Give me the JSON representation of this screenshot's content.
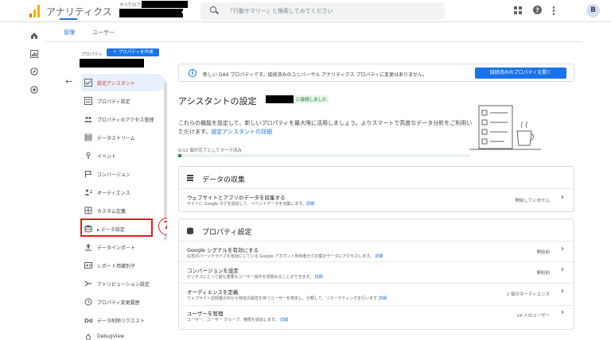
{
  "header": {
    "app_title": "アナリティクス",
    "account_label": "すべてのアカウント",
    "search_placeholder": "「行動サマリー」と検索してみてください",
    "avatar_letter": "B"
  },
  "tabs": [
    {
      "label": "管理"
    },
    {
      "label": "ユーザー"
    }
  ],
  "admin": {
    "property_label": "プロパティ",
    "create_property_button": "＋ プロパティを作成",
    "nav_items": [
      {
        "label": "設定アシスタント"
      },
      {
        "label": "プロパティ設定"
      },
      {
        "label": "プロパティのアクセス管理"
      },
      {
        "label": "データストリーム"
      },
      {
        "label": "イベント"
      },
      {
        "label": "コンバージョン"
      },
      {
        "label": "オーディエンス"
      },
      {
        "label": "カスタム定義"
      },
      {
        "label": "▸ データ設定"
      },
      {
        "label": "データインポート"
      },
      {
        "label": "レポート用識別子"
      },
      {
        "label": "アトリビューション設定"
      },
      {
        "label": "プロパティ変更履歴"
      },
      {
        "label": "データ削除リクエスト"
      },
      {
        "label": "DebugView"
      }
    ]
  },
  "annotation": {
    "step_number": "7",
    "highlight_color": "#e02020"
  },
  "main": {
    "banner_text": "新しい GA4 プロパティです。接続済みのユニバーサル アナリティクス プロパティに変更はありません。",
    "banner_button": "接続済みのプロパティを開く",
    "page_title": "アシスタントの設定",
    "title_badge": "に接続しました",
    "intro_text": "これらの機能を設定して、新しいプロパティを最大限に活用しましょう。よりスマートで高度なデータ分析をご利用いただけます。",
    "intro_link": "設定アシスタントの詳細",
    "progress_label": "0/12 個が完了としてマーク済み",
    "progress_fraction": 0.01,
    "collection_card": {
      "title": "データの収集",
      "rows": [
        {
          "title": "ウェブサイトとアプリのデータを収集する",
          "desc": "サイトに Google タグを追加して、イベントデータを収集します。",
          "link": "詳細",
          "status": "開始していません"
        }
      ]
    },
    "property_card": {
      "title": "プロパティ設定",
      "rows": [
        {
          "title": "Google シグナルを有効にする",
          "desc": "広告のパーソナライズを有効にしている Google アカウント所有者からの集計データにアクセスします。",
          "link": "詳細",
          "status": "開始前"
        },
        {
          "title": "コンバージョンを設定",
          "desc": "ビジネスにとって最も重要なユーザー操作を見極めることができます。",
          "link": "詳細",
          "status": "開始前"
        },
        {
          "title": "オーディエンスを定義",
          "desc": "ウェブサイト訪問者の中から特定の属性を持つユーザーを特定し、分類して、リマーケティングを行います",
          "link": "詳細",
          "status": "2 個のオーディエンス"
        },
        {
          "title": "ユーザーを管理",
          "desc": "ユーザー、ユーザー グループ、権限を追加します。",
          "link": "詳細",
          "status": "14 人のユーザー"
        }
      ]
    }
  },
  "colors": {
    "accent": "#1a73e8",
    "active_nav_text": "#d93025",
    "progress": "#1e8e3e"
  }
}
